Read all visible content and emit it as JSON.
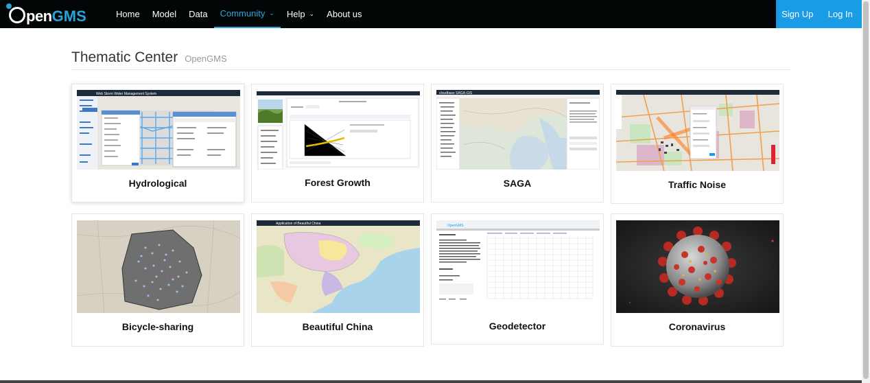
{
  "brand": {
    "part1": "pen",
    "part2": "GMS"
  },
  "nav": {
    "items": [
      {
        "label": "Home"
      },
      {
        "label": "Model"
      },
      {
        "label": "Data"
      },
      {
        "label": "Community"
      },
      {
        "label": "Help"
      },
      {
        "label": "About us"
      }
    ],
    "sign_up": "Sign Up",
    "log_in": "Log In"
  },
  "page": {
    "title": "Thematic Center",
    "subtitle": "OpenGMS"
  },
  "thumbs": {
    "hydrological": "Web Storm Water Management System",
    "saga": "cloudbase SAGA-GIS",
    "china": "Application of Beautiful China",
    "geo": "OpenGMS"
  },
  "cards": [
    {
      "label": "Hydrological"
    },
    {
      "label": "Forest Growth"
    },
    {
      "label": "SAGA"
    },
    {
      "label": "Traffic Noise"
    },
    {
      "label": "Bicycle-sharing"
    },
    {
      "label": "Beautiful China"
    },
    {
      "label": "Geodetector"
    },
    {
      "label": "Coronavirus"
    }
  ],
  "colors": {
    "nav_bg": "#030606",
    "accent": "#2aa6e0",
    "auth_bg": "#1a9be6"
  }
}
